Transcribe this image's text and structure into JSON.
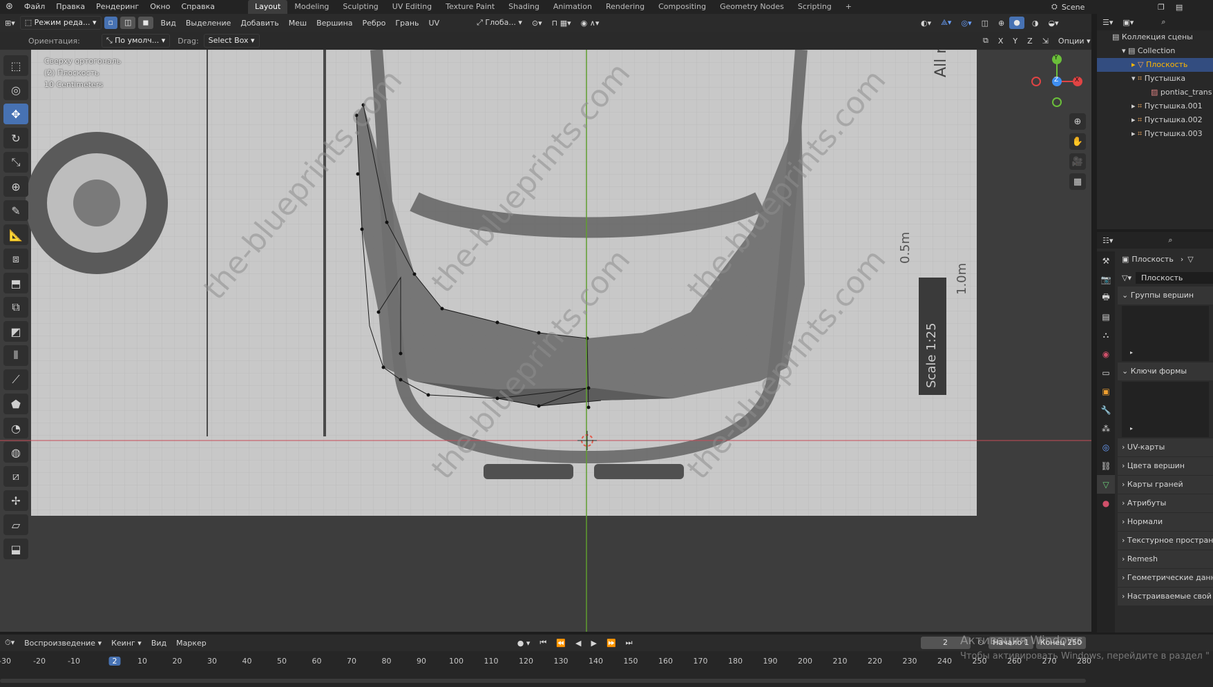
{
  "menu": [
    "Файл",
    "Правка",
    "Рендеринг",
    "Окно",
    "Справка"
  ],
  "workspaces": [
    "Layout",
    "Modeling",
    "Sculpting",
    "UV Editing",
    "Texture Paint",
    "Shading",
    "Animation",
    "Rendering",
    "Compositing",
    "Geometry Nodes",
    "Scripting"
  ],
  "active_workspace": "Layout",
  "scene_name": "Scene",
  "header": {
    "mode": "Режим реда...",
    "menus": [
      "Вид",
      "Выделение",
      "Добавить",
      "Меш",
      "Вершина",
      "Ребро",
      "Грань",
      "UV"
    ],
    "transform_orientation": "Глоба..."
  },
  "tool_header": {
    "orientation_label": "Ориентация:",
    "orientation_value": "По умолч...",
    "drag_label": "Drag:",
    "drag_value": "Select Box",
    "axes": [
      "X",
      "Y",
      "Z"
    ],
    "options": "Опции"
  },
  "viewport": {
    "view_name": "Сверху ортогональ",
    "object_name": "(2) Плоскость",
    "scale": "10 Centimeters",
    "watermark": "the-blueprints.com",
    "blueprint_labels": [
      "All measure",
      "0.5m",
      "1.0m",
      "Scale 1:25"
    ]
  },
  "gizmo": {
    "x": "X",
    "y": "Y",
    "z": "Z",
    "colors": {
      "x": "#e04444",
      "y": "#6bbf3a",
      "z": "#3f8ef0"
    }
  },
  "outliner": {
    "root": "Коллекция сцены",
    "items": [
      {
        "label": "Collection",
        "icon": "collection-icon",
        "depth": 1
      },
      {
        "label": "Плоскость",
        "icon": "mesh-icon",
        "depth": 2,
        "selected": true
      },
      {
        "label": "Пустышка",
        "icon": "empty-icon",
        "depth": 2
      },
      {
        "label": "pontiac_trans",
        "icon": "image-icon",
        "depth": 3
      },
      {
        "label": "Пустышка.001",
        "icon": "empty-icon",
        "depth": 2
      },
      {
        "label": "Пустышка.002",
        "icon": "empty-icon",
        "depth": 2
      },
      {
        "label": "Пустышка.003",
        "icon": "empty-icon",
        "depth": 2
      }
    ]
  },
  "properties": {
    "breadcrumb": "Плоскость",
    "mesh_name": "Плоскость",
    "open_panels": [
      "Группы вершин",
      "Ключи формы"
    ],
    "closed_panels": [
      "UV-карты",
      "Цвета вершин",
      "Карты граней",
      "Атрибуты",
      "Нормали",
      "Текстурное простран",
      "Remesh",
      "Геометрические данн",
      "Настраиваемые свой"
    ]
  },
  "timeline": {
    "menus": [
      "Воспроизведение",
      "Кеинг",
      "Вид",
      "Маркер"
    ],
    "current_frame": "2",
    "start_label": "Начало",
    "start": "1",
    "end_label": "Конец",
    "end": "250",
    "ticks": [
      "-30",
      "-20",
      "-10",
      "2",
      "10",
      "20",
      "30",
      "40",
      "50",
      "60",
      "70",
      "80",
      "90",
      "100",
      "110",
      "120",
      "130",
      "140",
      "150",
      "160",
      "170",
      "180",
      "190",
      "200",
      "210",
      "220",
      "230",
      "240",
      "250",
      "260",
      "270",
      "280"
    ]
  },
  "activation_notice": {
    "title": "Активация Windows",
    "body": "Чтобы активировать Windows, перейдите в раздел \""
  }
}
